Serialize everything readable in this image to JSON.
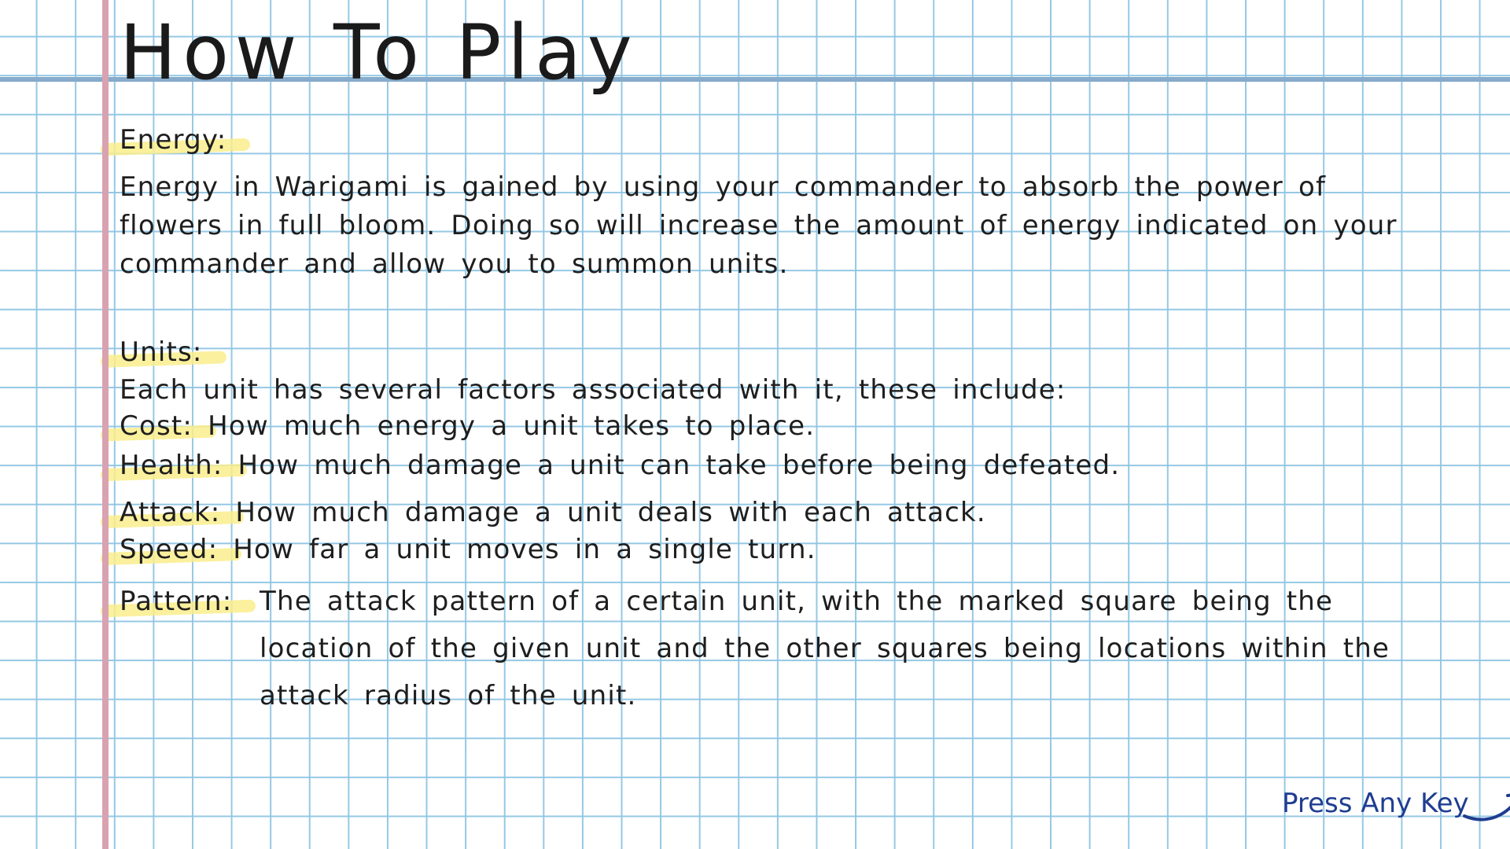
{
  "title": "How To Play",
  "energy": {
    "heading": "Energy:",
    "text": "Energy in Warigami is gained by using your commander to absorb the power of flowers in full bloom. Doing so will increase the amount of energy indicated on your commander and allow you to summon units."
  },
  "units": {
    "heading": "Units:",
    "intro": "Each unit has several factors associated with it, these include:",
    "factors": [
      {
        "label": "Cost:",
        "description": "How much energy a unit takes to place."
      },
      {
        "label": "Health:",
        "description": "How much damage a unit can take before being defeated."
      },
      {
        "label": "Attack:",
        "description": "How much damage a unit deals with each attack."
      },
      {
        "label": "Speed:",
        "description": "How far a unit moves in a single turn."
      },
      {
        "label": "Pattern:",
        "description": "The attack pattern of a certain unit, with the marked square being the location of the given unit and the other squares being locations within the attack radius of the unit."
      }
    ]
  },
  "footer": {
    "prompt": "Press Any Key",
    "icon": "curved-arrow-icon"
  },
  "colors": {
    "grid": "#8fc5e3",
    "header_line": "#86abcb",
    "margin_line": "#d8a2b0",
    "highlight": "#faed8c",
    "prompt": "#1f3d91"
  }
}
